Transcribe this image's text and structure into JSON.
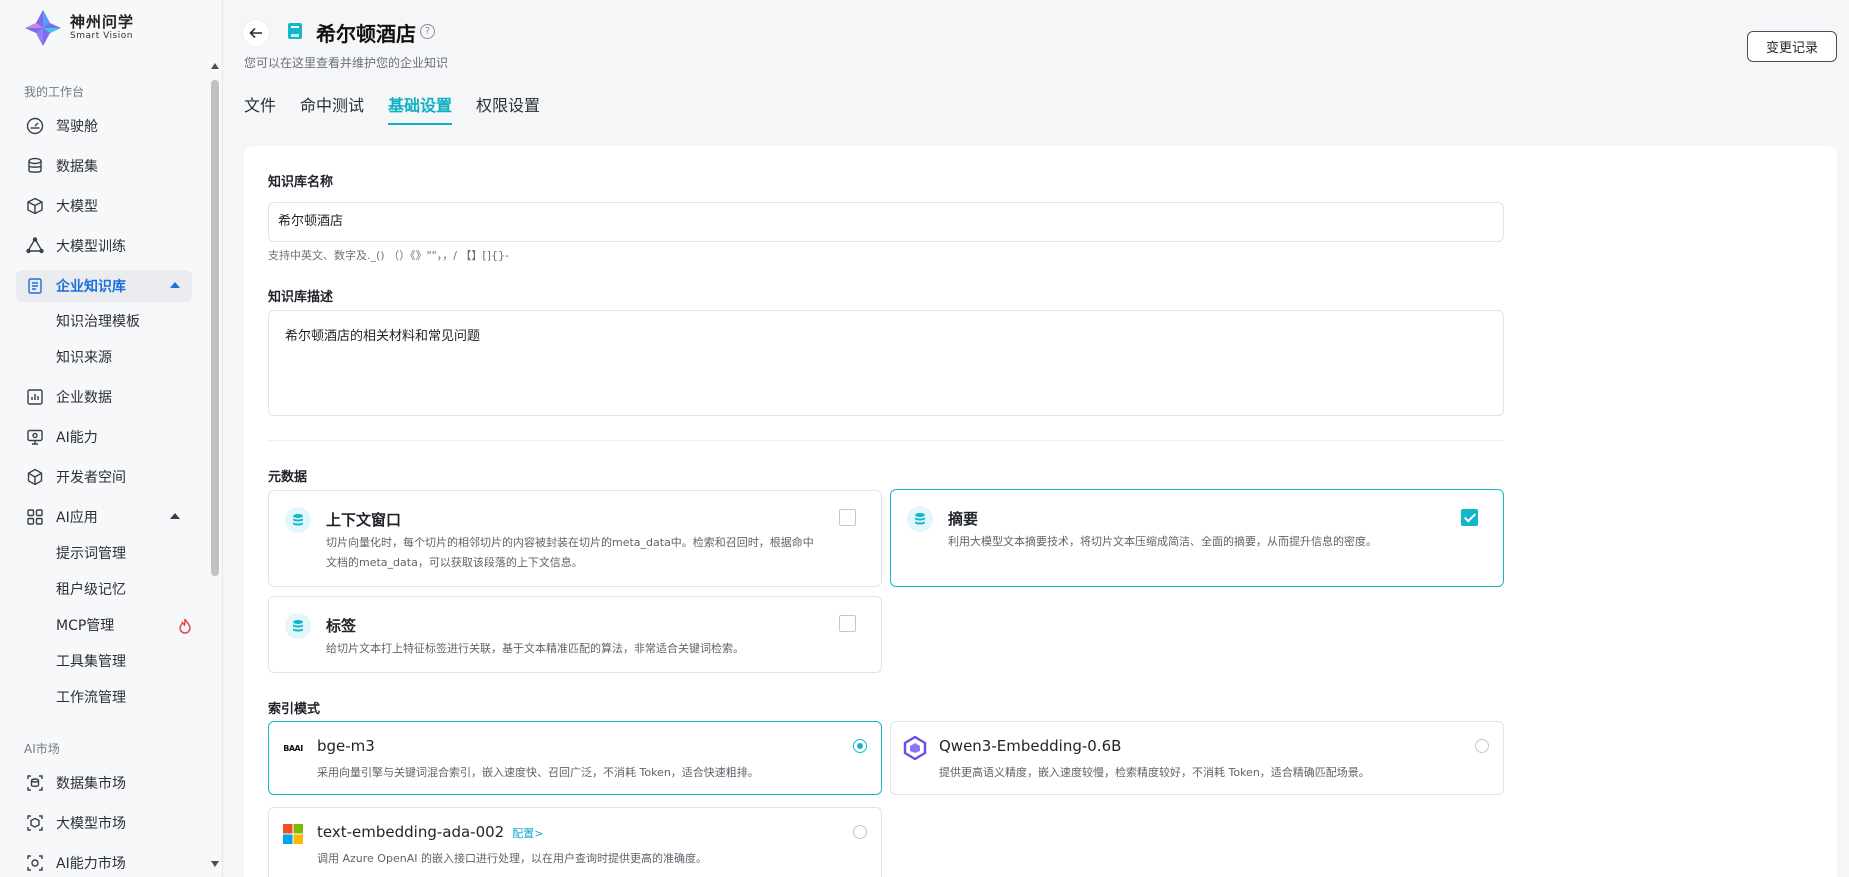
{
  "brand": {
    "name_cn": "神州问学",
    "name_en": "Smart Vision"
  },
  "sidebar": {
    "group_workspace": "我的工作台",
    "items": [
      {
        "label": "驾驶舱",
        "icon": "dashboard-icon"
      },
      {
        "label": "数据集",
        "icon": "database-icon"
      },
      {
        "label": "大模型",
        "icon": "cube-icon"
      },
      {
        "label": "大模型训练",
        "icon": "training-icon"
      },
      {
        "label": "企业知识库",
        "icon": "knowledge-icon"
      },
      {
        "label": "企业数据",
        "icon": "chart-icon"
      },
      {
        "label": "AI能力",
        "icon": "monitor-icon"
      },
      {
        "label": "开发者空间",
        "icon": "hex-icon"
      },
      {
        "label": "AI应用",
        "icon": "grid-icon"
      }
    ],
    "knowledge_sub": [
      "知识治理模板",
      "知识来源"
    ],
    "ai_app_sub": [
      "提示词管理",
      "租户级记忆",
      "MCP管理",
      "工具集管理",
      "工作流管理"
    ],
    "group_market": "AI市场",
    "market_items": [
      {
        "label": "数据集市场",
        "icon": "dataset-market-icon"
      },
      {
        "label": "大模型市场",
        "icon": "model-market-icon"
      },
      {
        "label": "AI能力市场",
        "icon": "ai-market-icon"
      }
    ]
  },
  "header": {
    "title": "希尔顿酒店",
    "subtitle": "您可以在这里查看并维护您的企业知识",
    "change_log": "变更记录",
    "tabs": [
      "文件",
      "命中测试",
      "基础设置",
      "权限设置"
    ],
    "active_tab": "基础设置"
  },
  "form": {
    "name_label": "知识库名称",
    "name_value": "希尔顿酒店",
    "name_hint": "支持中英文、数字及._() （）《》\"\"，，/ 【】[]{}-",
    "desc_label": "知识库描述",
    "desc_value": "希尔顿酒店的相关材料和常见问题",
    "metadata_label": "元数据",
    "metadata": [
      {
        "title": "上下文窗口",
        "desc_line1": "切片向量化时，每个切片的相邻切片的内容被封装在切片的meta_data中。检索和召回时，根据命中",
        "desc_line2": "文档的meta_data，可以获取该段落的上下文信息。",
        "checked": false
      },
      {
        "title": "摘要",
        "desc_line1": "利用大模型文本摘要技术，将切片文本压缩成简洁、全面的摘要，从而提升信息的密度。",
        "checked": true
      },
      {
        "title": "标签",
        "desc_line1": "给切片文本打上特征标签进行关联，基于文本精准匹配的算法，非常适合关键词检索。",
        "checked": false
      }
    ],
    "index_label": "索引模式",
    "models": [
      {
        "name": "bge-m3",
        "logo_text": "BAAI",
        "desc": "采用向量引擎与关键词混合索引，嵌入速度快、召回广泛，不消耗 Token，适合快速粗排。",
        "selected": true
      },
      {
        "name": "Qwen3-Embedding-0.6B",
        "desc": "提供更高语义精度，嵌入速度较慢，检索精度较好，不消耗 Token，适合精确匹配场景。",
        "selected": false
      },
      {
        "name": "text-embedding-ada-002",
        "config": "配置>",
        "desc": "调用 Azure OpenAI 的嵌入接口进行处理，以在用户查询时提供更高的准确度。",
        "selected": false
      }
    ]
  },
  "colors": {
    "accent": "#12b8c9",
    "active_nav": "#1f6fdb",
    "hot": "#e5484d"
  }
}
